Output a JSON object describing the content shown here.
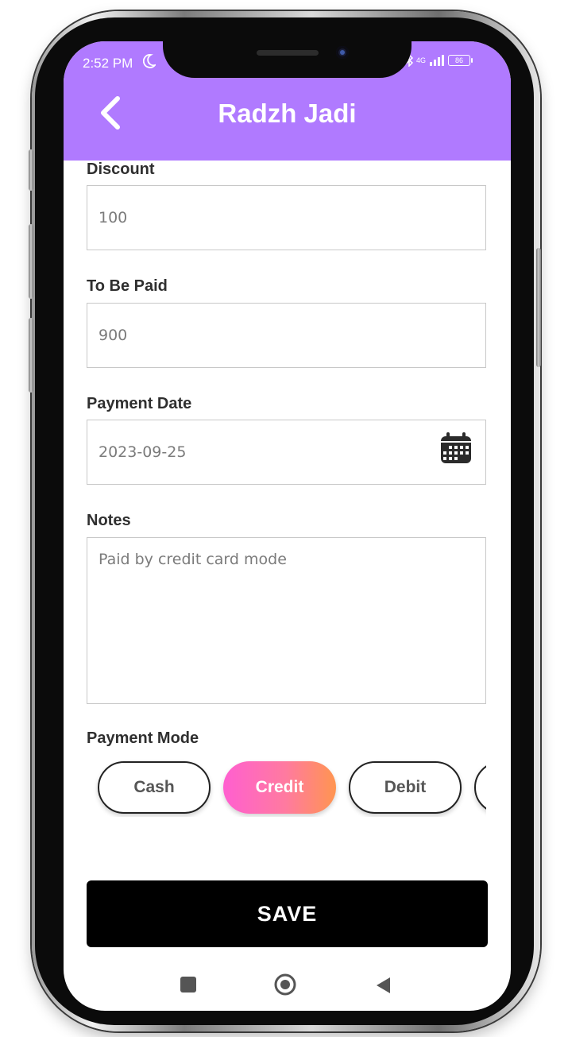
{
  "status_bar": {
    "time": "2:52 PM",
    "network": "4G",
    "battery": "86"
  },
  "header": {
    "title": "Radzh Jadi",
    "back_icon": "back-arrow-icon"
  },
  "form": {
    "discount": {
      "label": "Discount",
      "value": "100"
    },
    "to_be_paid": {
      "label": "To Be Paid",
      "value": "900"
    },
    "payment_date": {
      "label": "Payment Date",
      "value": "2023-09-25",
      "icon": "calendar-icon"
    },
    "notes": {
      "label": "Notes",
      "value": "Paid by credit card mode"
    },
    "payment_mode": {
      "label": "Payment Mode",
      "options": [
        "Cash",
        "Credit",
        "Debit",
        ""
      ],
      "selected": "Credit"
    }
  },
  "save_label": "SAVE",
  "colors": {
    "header": "#b07aff",
    "save_button": "#000000",
    "chip_active_start": "#ff5fd0",
    "chip_active_end": "#ff9550"
  }
}
